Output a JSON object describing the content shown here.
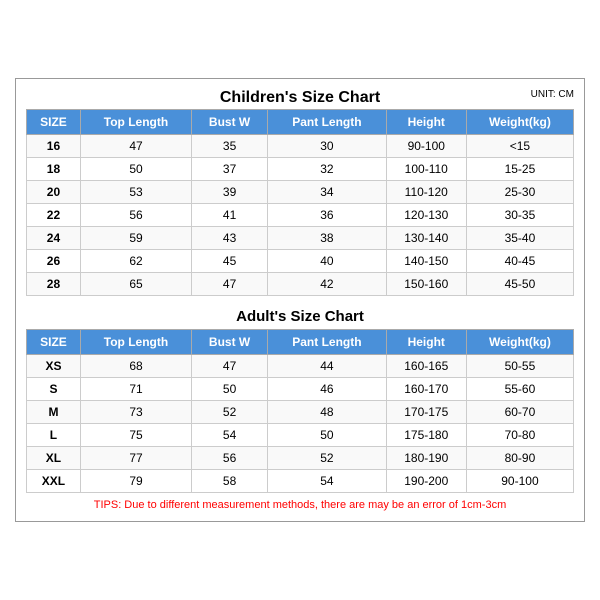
{
  "mainTitle": "Children's Size Chart",
  "unitLabel": "UNIT: CM",
  "childHeaders": [
    "SIZE",
    "Top Length",
    "Bust W",
    "Pant Length",
    "Height",
    "Weight(kg)"
  ],
  "childRows": [
    [
      "16",
      "47",
      "35",
      "30",
      "90-100",
      "<15"
    ],
    [
      "18",
      "50",
      "37",
      "32",
      "100-110",
      "15-25"
    ],
    [
      "20",
      "53",
      "39",
      "34",
      "110-120",
      "25-30"
    ],
    [
      "22",
      "56",
      "41",
      "36",
      "120-130",
      "30-35"
    ],
    [
      "24",
      "59",
      "43",
      "38",
      "130-140",
      "35-40"
    ],
    [
      "26",
      "62",
      "45",
      "40",
      "140-150",
      "40-45"
    ],
    [
      "28",
      "65",
      "47",
      "42",
      "150-160",
      "45-50"
    ]
  ],
  "adultTitle": "Adult's Size Chart",
  "adultHeaders": [
    "SIZE",
    "Top Length",
    "Bust W",
    "Pant Length",
    "Height",
    "Weight(kg)"
  ],
  "adultRows": [
    [
      "XS",
      "68",
      "47",
      "44",
      "160-165",
      "50-55"
    ],
    [
      "S",
      "71",
      "50",
      "46",
      "160-170",
      "55-60"
    ],
    [
      "M",
      "73",
      "52",
      "48",
      "170-175",
      "60-70"
    ],
    [
      "L",
      "75",
      "54",
      "50",
      "175-180",
      "70-80"
    ],
    [
      "XL",
      "77",
      "56",
      "52",
      "180-190",
      "80-90"
    ],
    [
      "XXL",
      "79",
      "58",
      "54",
      "190-200",
      "90-100"
    ]
  ],
  "tips": "TIPS: Due to different measurement methods, there are may be an error of 1cm-3cm"
}
